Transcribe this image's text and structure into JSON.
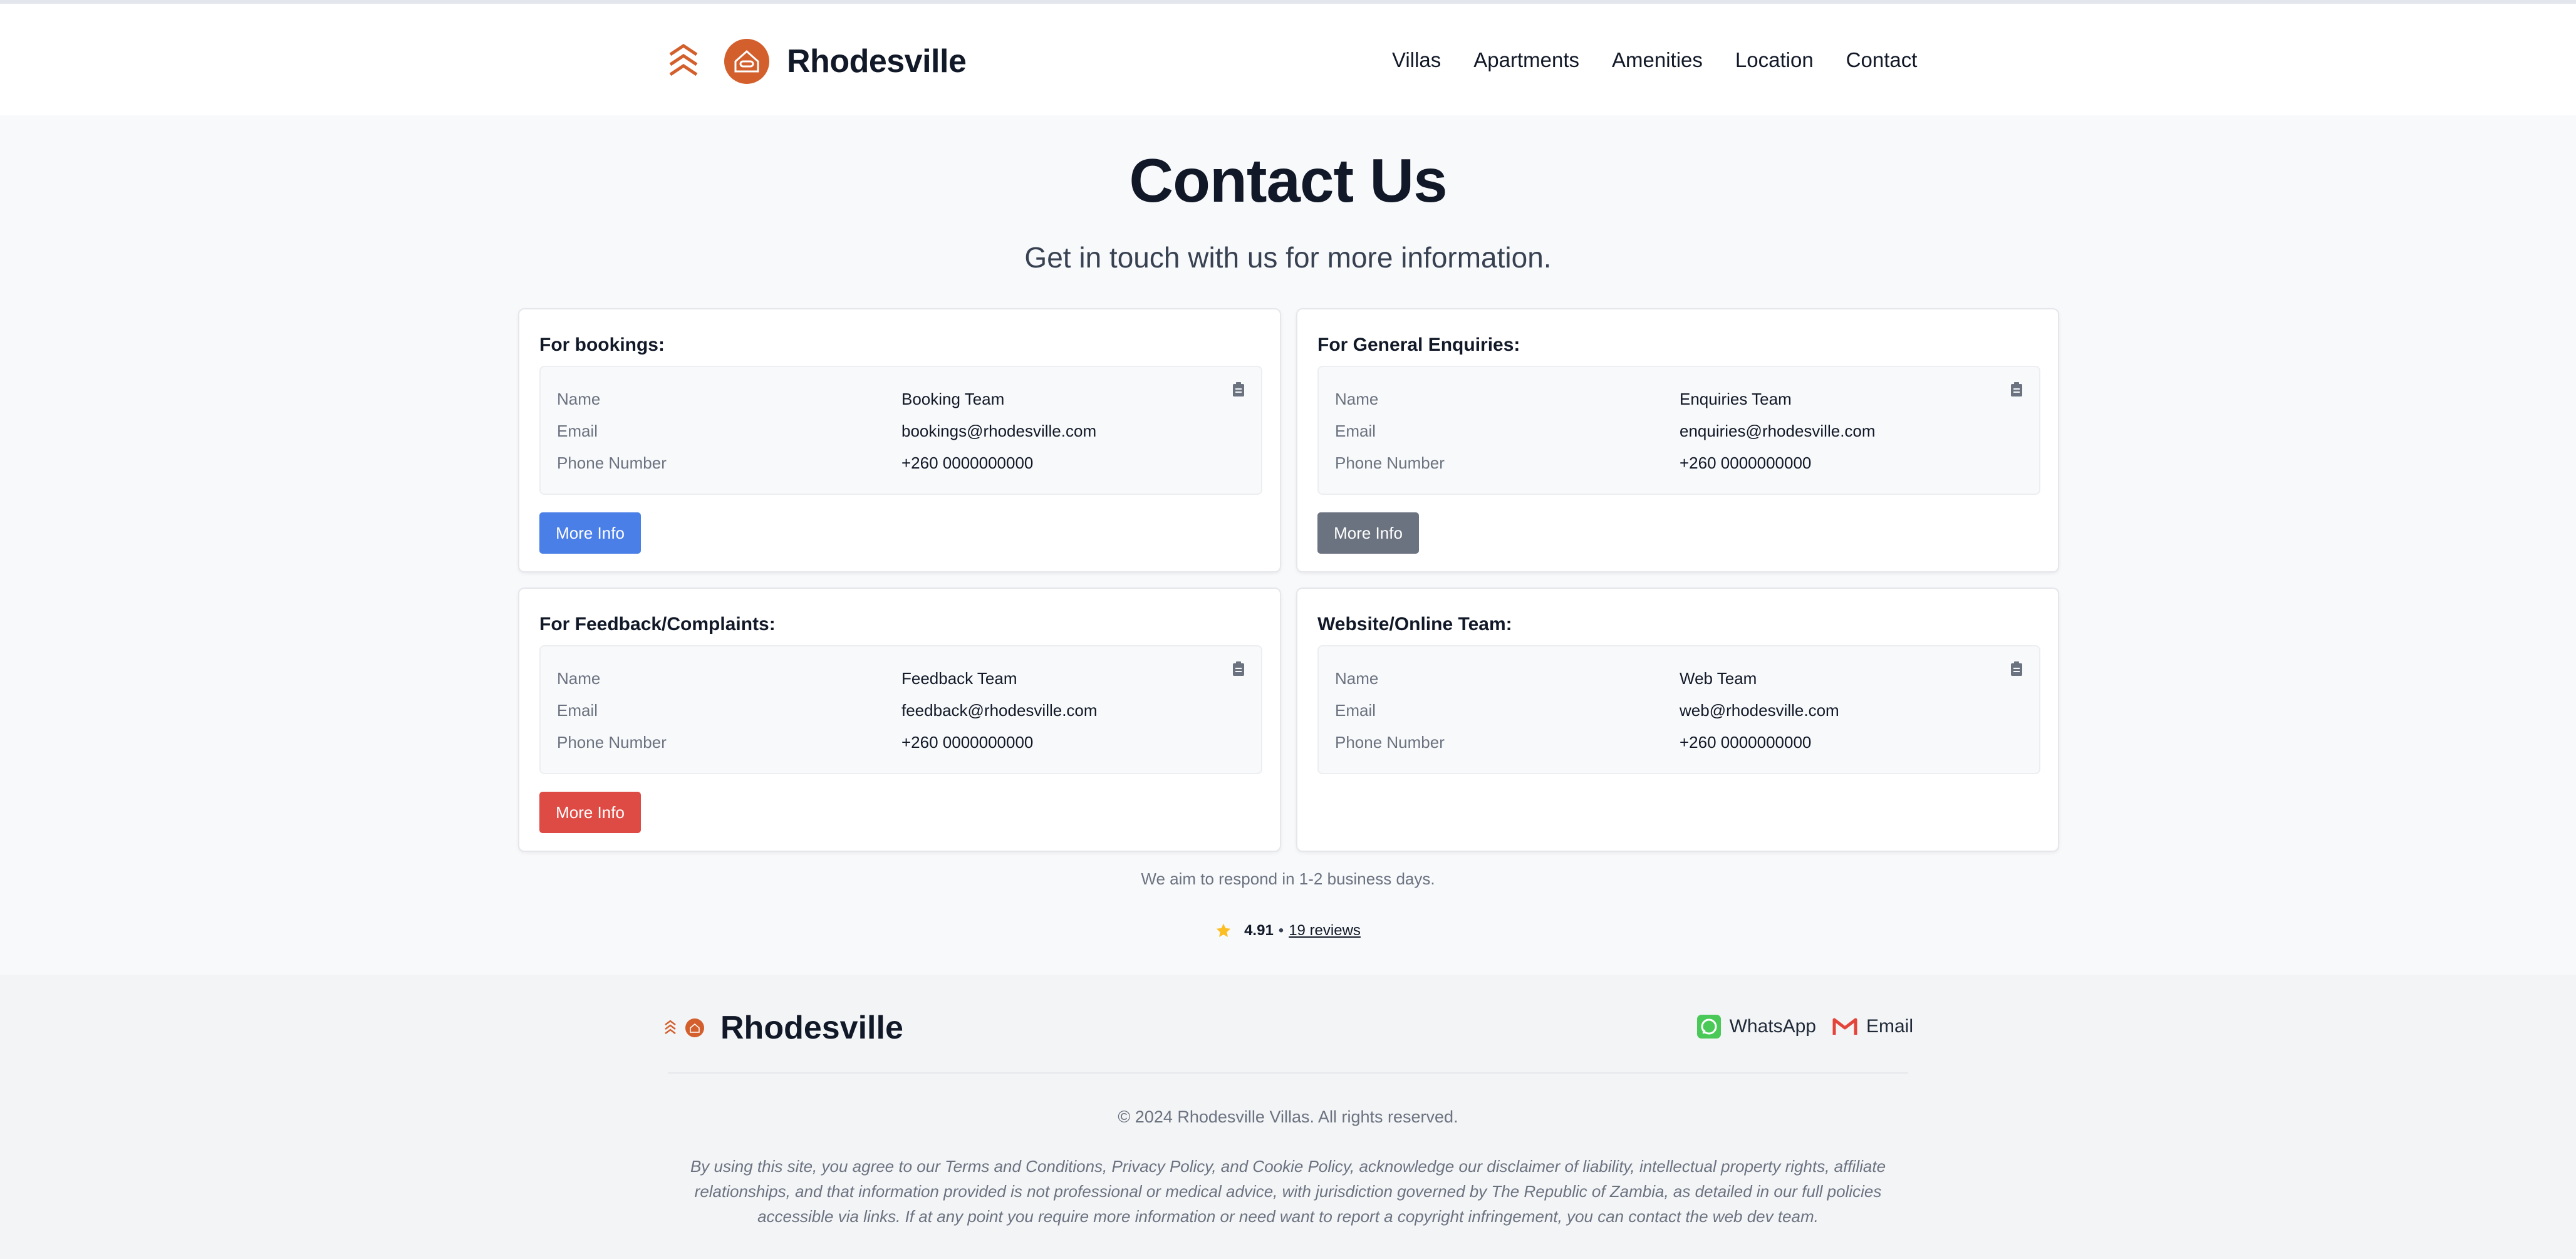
{
  "brand": {
    "name": "Rhodesville",
    "accent_color": "#d35f2c"
  },
  "nav": {
    "items": [
      "Villas",
      "Apartments",
      "Amenities",
      "Location",
      "Contact"
    ]
  },
  "hero": {
    "title": "Contact Us",
    "subtitle": "Get in touch with us for more information."
  },
  "labels": {
    "name": "Name",
    "email": "Email",
    "phone": "Phone Number"
  },
  "cards": [
    {
      "title": "For bookings:",
      "name": "Booking Team",
      "email": "bookings@rhodesville.com",
      "phone": "+260 0000000000",
      "button": "More Info",
      "button_color": "#4a7fe8"
    },
    {
      "title": "For General Enquiries:",
      "name": "Enquiries Team",
      "email": "enquiries@rhodesville.com",
      "phone": "+260 0000000000",
      "button": "More Info",
      "button_color": "#6b7280"
    },
    {
      "title": "For Feedback/Complaints:",
      "name": "Feedback Team",
      "email": "feedback@rhodesville.com",
      "phone": "+260 0000000000",
      "button": "More Info",
      "button_color": "#de4b45"
    },
    {
      "title": "Website/Online Team:",
      "name": "Web Team",
      "email": "web@rhodesville.com",
      "phone": "+260 0000000000"
    }
  ],
  "respond_note": "We aim to respond in 1-2 business days.",
  "rating": {
    "score": "4.91",
    "separator": "•",
    "reviews": "19 reviews",
    "star_color": "#fbbf24"
  },
  "footer": {
    "brand": "Rhodesville",
    "whatsapp": "WhatsApp",
    "email": "Email",
    "copyright": "© 2024 Rhodesville Villas. All rights reserved.",
    "legal": "By using this site, you agree to our Terms and Conditions, Privacy Policy, and Cookie Policy, acknowledge our disclaimer of liability, intellectual property rights, affiliate relationships, and that information provided is not professional or medical advice, with jurisdiction governed by The Republic of Zambia, as detailed in our full policies accessible via links. If at any point you require more information or need want to report a copyright infringement, you can contact the web dev team."
  }
}
